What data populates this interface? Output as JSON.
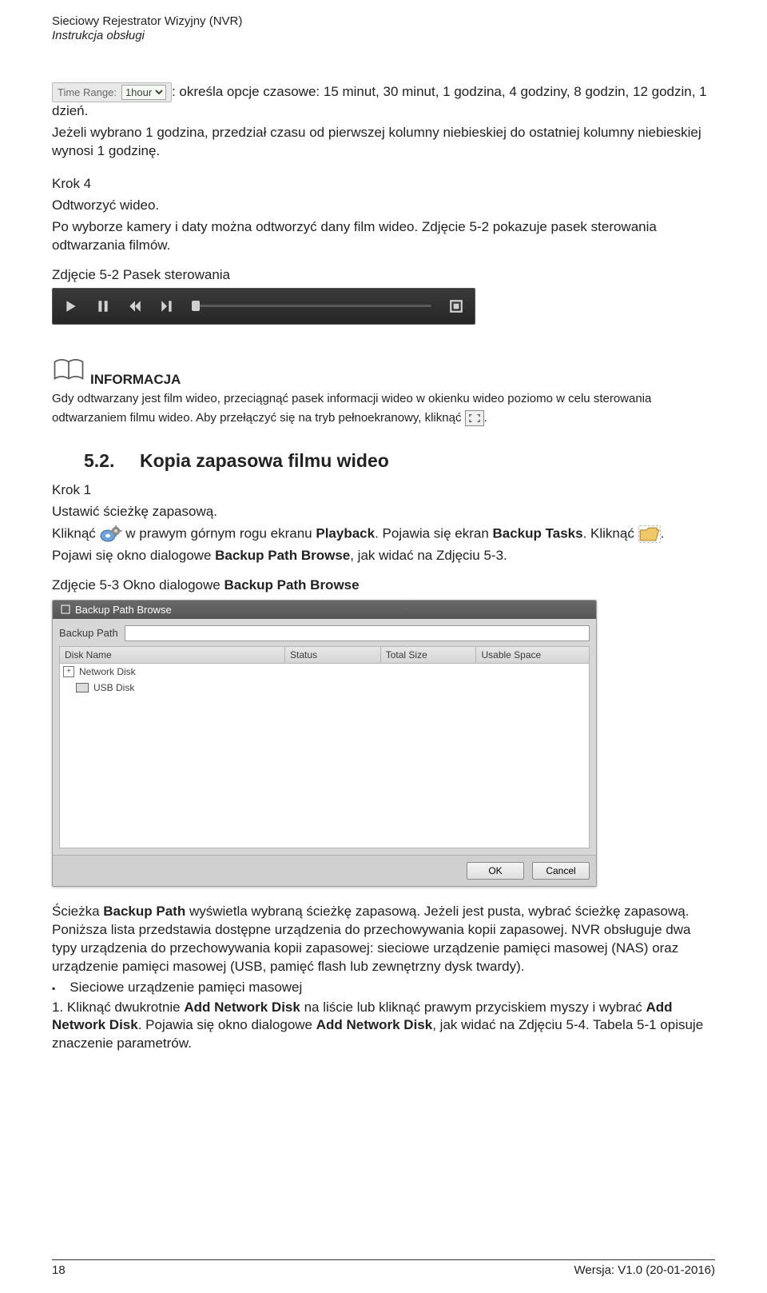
{
  "header": {
    "title": "Sieciowy Rejestrator Wizyjny (NVR)",
    "subtitle": "Instrukcja obsługi"
  },
  "time_range": {
    "label": "Time Range:",
    "options": [
      "15min",
      "30min",
      "1hour",
      "4hour",
      "8hour",
      "12hour",
      "1day"
    ],
    "selected": "1hour"
  },
  "p1_a": ": określa opcje czasowe: 15 minut, 30 minut, 1 godzina, 4 godziny, 8 godzin, 12 godzin, 1 dzień.",
  "p1_b": "Jeżeli wybrano 1 godzina, przedział czasu od pierwszej kolumny niebieskiej do ostatniej kolumny niebieskiej wynosi 1 godzinę.",
  "step4_label": "Krok 4",
  "step4_a": "Odtworzyć wideo.",
  "step4_b": "Po wyborze kamery i daty można odtworzyć dany film wideo. Zdjęcie 5-2 pokazuje pasek sterowania odtwarzania filmów.",
  "fig52_caption": "Zdjęcie 5-2 Pasek sterowania",
  "info": {
    "title": "INFORMACJA",
    "line1": "Gdy odtwarzany jest film wideo, przeciągnąć pasek informacji wideo w okienku wideo poziomo w celu sterowania",
    "line2_a": "odtwarzaniem filmu wideo. Aby przełączyć się na tryb pełnoekranowy, kliknąć ",
    "line2_b": "."
  },
  "section52": {
    "num": "5.2.",
    "title": "Kopia zapasowa filmu wideo"
  },
  "step1_label": "Krok 1",
  "step1_a": "Ustawić ścieżkę zapasową.",
  "step1_b_before": "Kliknąć ",
  "step1_b_mid1": " w prawym górnym rogu ekranu ",
  "step1_b_bold1": "Playback",
  "step1_b_mid2": ". Pojawia się ekran ",
  "step1_b_bold2": "Backup Tasks",
  "step1_b_mid3": ". Kliknąć ",
  "step1_b_end": ".",
  "step1_c_a": "Pojawi się okno dialogowe ",
  "step1_c_bold": "Backup Path Browse",
  "step1_c_b": ", jak widać na Zdjęciu 5-3.",
  "fig53_caption_a": "Zdjęcie 5-3 Okno dialogowe ",
  "fig53_caption_b": "Backup Path Browse",
  "dialog": {
    "title": "Backup Path Browse",
    "path_label": "Backup Path",
    "path_value": "",
    "columns": [
      "Disk Name",
      "Status",
      "Total Size",
      "Usable Space"
    ],
    "rows": [
      {
        "expander": "+",
        "label": "Network Disk"
      },
      {
        "expander": "",
        "label": "USB Disk"
      }
    ],
    "ok": "OK",
    "cancel": "Cancel"
  },
  "after_dialog": {
    "p_a": "Ścieżka ",
    "p_bold1": "Backup Path",
    "p_b": " wyświetla wybraną ścieżkę zapasową. Jeżeli jest pusta, wybrać ścieżkę zapasową. Poniższa lista przedstawia dostępne urządzenia do przechowywania kopii zapasowej. NVR obsługuje dwa typy urządzenia do przechowywania kopii zapasowej: sieciowe urządzenie pamięci masowej (NAS) oraz urządzenie pamięci masowej (USB, pamięć flash lub zewnętrzny dysk twardy).",
    "bullet1": "Sieciowe urządzenie pamięci masowej",
    "num1": "1.    Kliknąć dwukrotnie ",
    "num1_bold1": "Add Network Disk",
    "num1_mid": " na liście lub kliknąć prawym przyciskiem myszy i wybrać ",
    "num1_bold2": "Add Network Disk",
    "num1_mid2": ". Pojawia się okno dialogowe ",
    "num1_bold3": "Add Network Disk",
    "num1_end": ", jak widać na Zdjęciu 5-4. Tabela 5-1 opisuje znaczenie parametrów."
  },
  "footer": {
    "page": "18",
    "version": "Wersja: V1.0 (20-01-2016)"
  }
}
